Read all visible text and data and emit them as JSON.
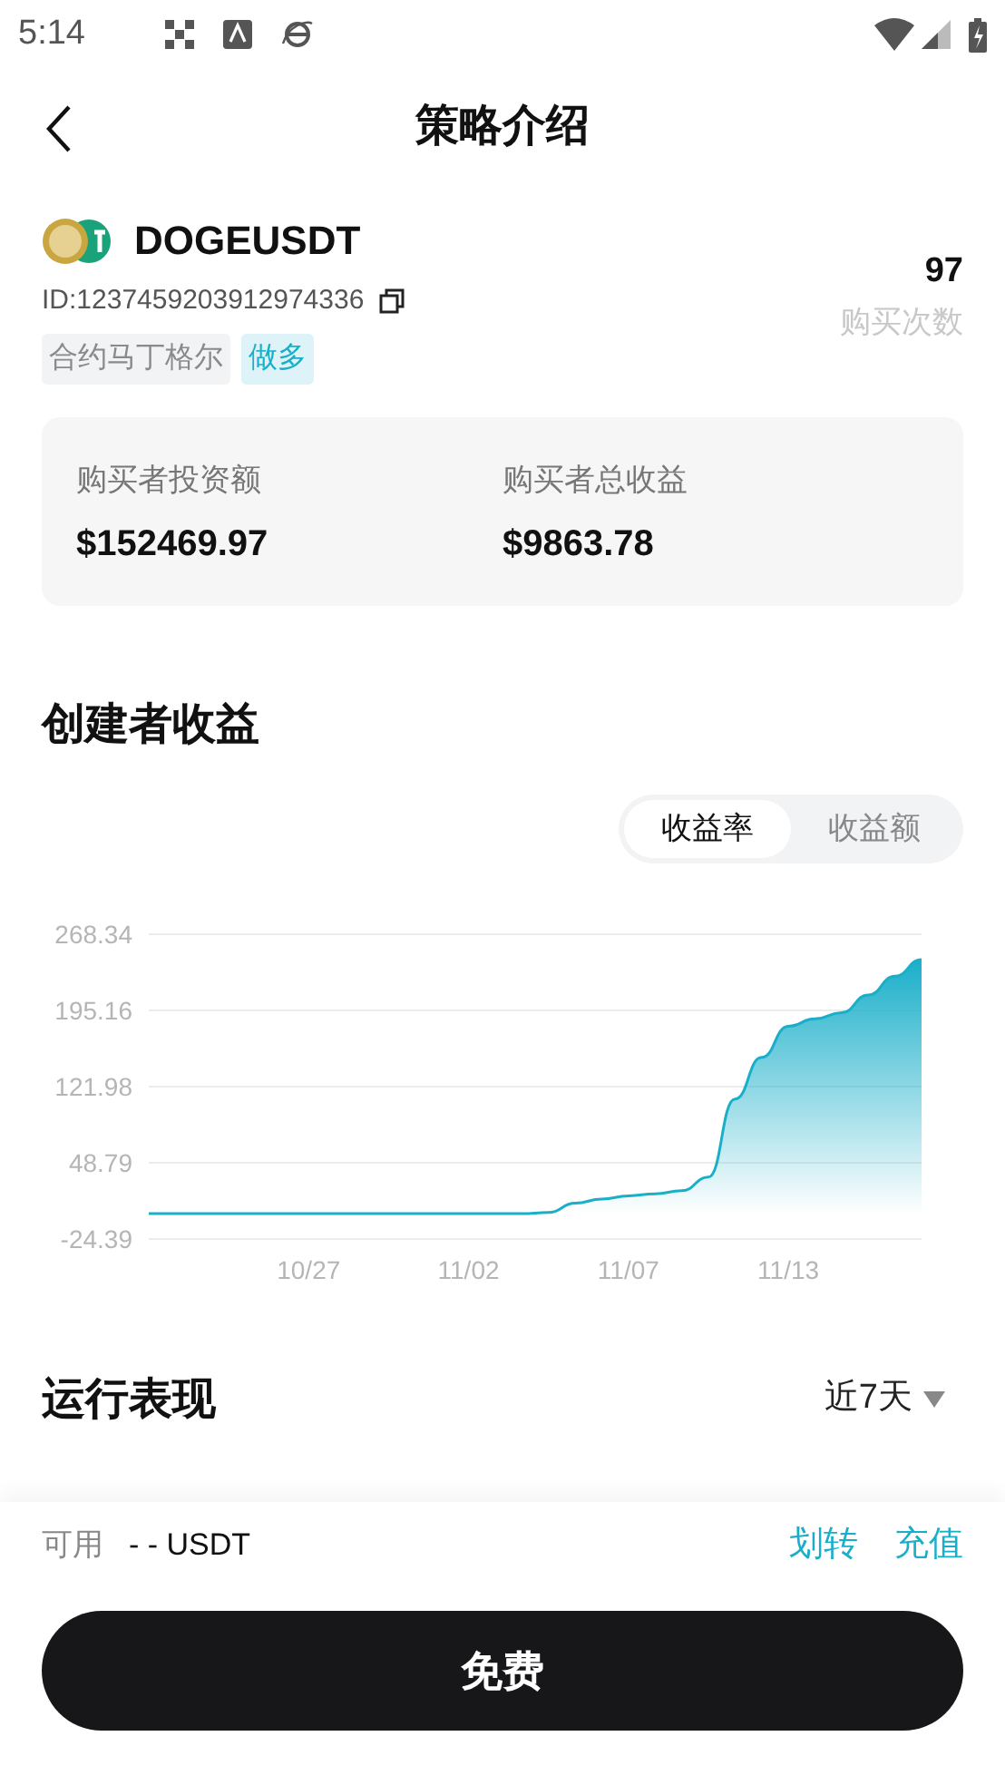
{
  "status_bar": {
    "time": "5:14"
  },
  "header": {
    "title": "策略介绍"
  },
  "strategy": {
    "symbol": "DOGEUSDT",
    "id": "ID:1237459203912974336",
    "tags": [
      {
        "label": "合约马丁格尔",
        "kind": "neutral"
      },
      {
        "label": "做多",
        "kind": "accent"
      }
    ],
    "buy_count": "97",
    "buy_count_label": "购买次数"
  },
  "stats": [
    {
      "label": "购买者投资额",
      "value": "$152469.97"
    },
    {
      "label": "购买者总收益",
      "value": "$9863.78"
    }
  ],
  "creator_earnings": {
    "title": "创建者收益",
    "tabs": [
      {
        "label": "收益率",
        "selected": true
      },
      {
        "label": "收益额",
        "selected": false
      }
    ],
    "chart_data": {
      "type": "area",
      "categories": [
        null,
        null,
        null,
        null,
        null,
        null,
        "10/27",
        null,
        null,
        null,
        null,
        null,
        "11/02",
        null,
        null,
        null,
        null,
        null,
        "11/07",
        null,
        null,
        null,
        null,
        null,
        "11/13",
        null,
        null,
        null,
        null,
        null
      ],
      "series": [
        {
          "color": "#1aafc9",
          "values": [
            0,
            0,
            0,
            0,
            0,
            0,
            0,
            0,
            0,
            0,
            0,
            0,
            0,
            0,
            0,
            1,
            10,
            14,
            17,
            19,
            22,
            35,
            110,
            150,
            180,
            187,
            193,
            210,
            228,
            244
          ]
        }
      ],
      "ylim": [
        -24.39,
        268.34
      ],
      "grid": true,
      "yticks": [
        {
          "value": 268.34,
          "label": "268.34"
        },
        {
          "value": 195.16,
          "label": "195.16"
        },
        {
          "value": 121.98,
          "label": "121.98"
        },
        {
          "value": 48.79,
          "label": "48.79"
        },
        {
          "value": -24.39,
          "label": "-24.39"
        }
      ]
    }
  },
  "performance": {
    "title": "运行表现",
    "period": "近7天"
  },
  "footer": {
    "available_label": "可用",
    "available_value": "- - USDT",
    "links": [
      "划转",
      "充值"
    ],
    "button": "免费"
  }
}
